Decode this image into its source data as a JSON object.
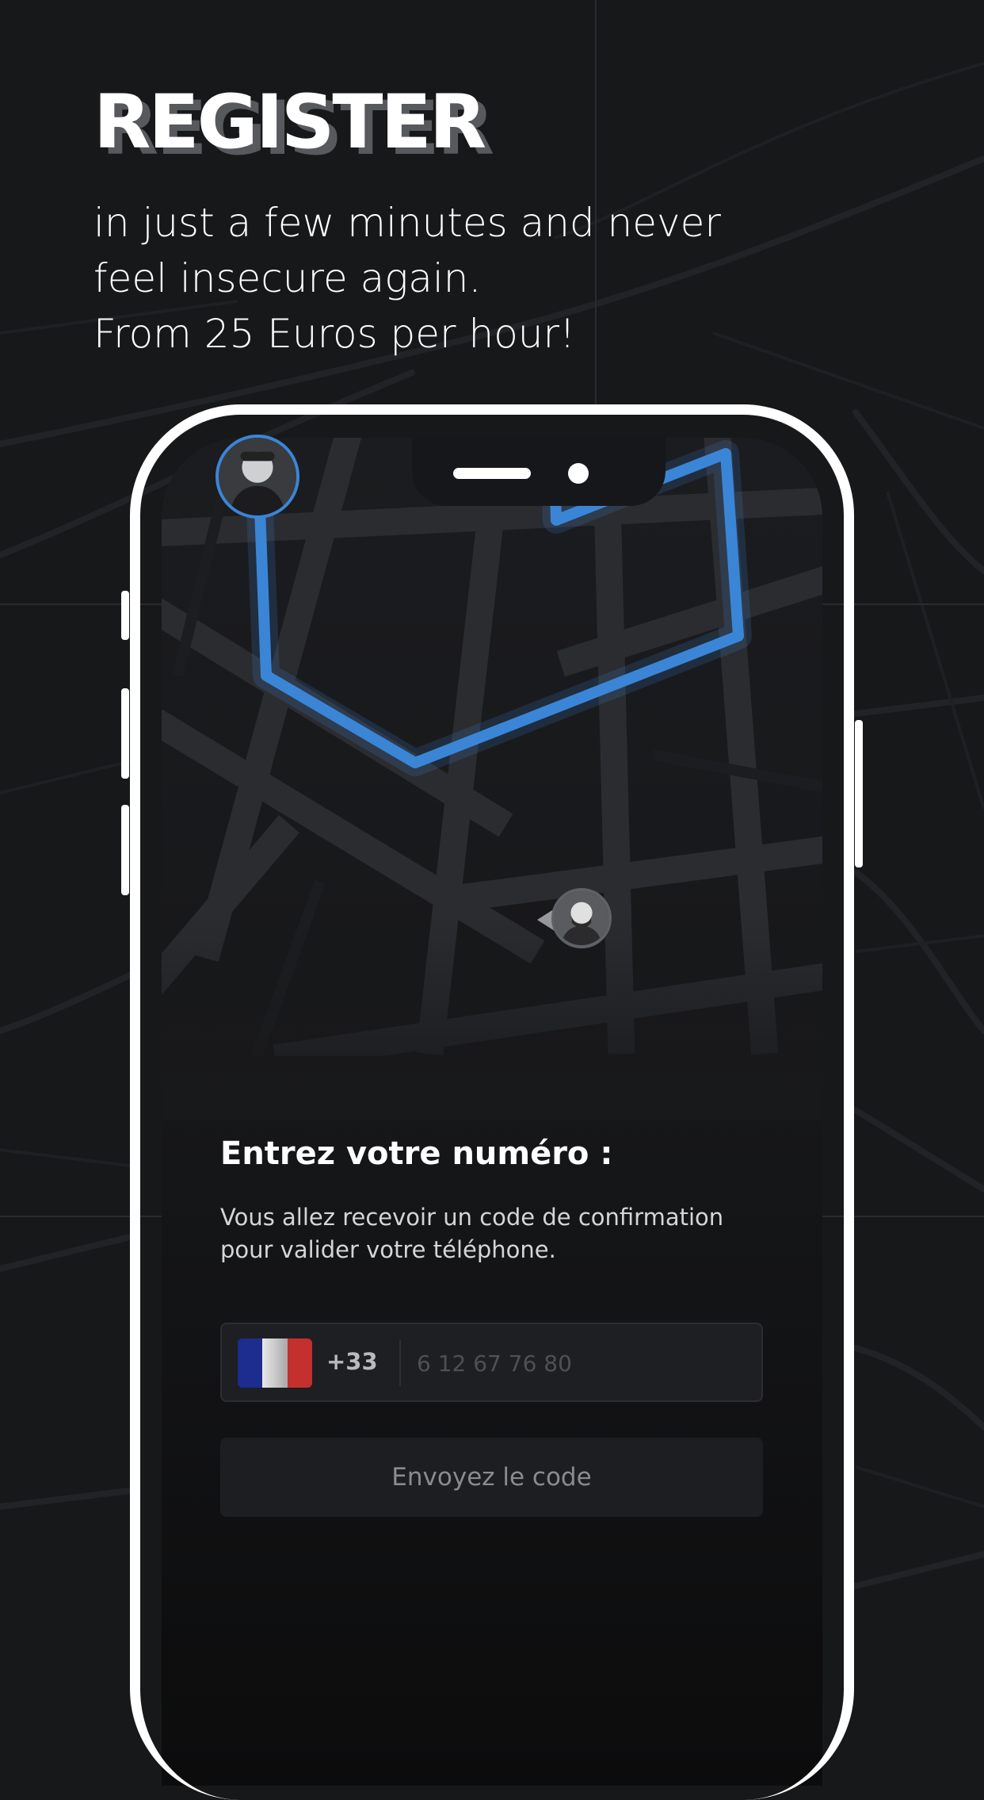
{
  "promo": {
    "headline": "REGISTER",
    "tagline_lines": [
      "in just a few minutes and never",
      "feel insecure again.",
      "From 25 Euros per hour!"
    ]
  },
  "app": {
    "form": {
      "title": "Entrez votre numéro :",
      "description_lines": [
        "Vous allez recevoir un code de confirmation",
        "pour valider votre téléphone."
      ],
      "country_flag": "france-flag-icon",
      "dial_code": "+33",
      "phone_placeholder": "6 12 67 76 80",
      "phone_value": "",
      "send_label": "Envoyez le code"
    },
    "map": {
      "route_color": "#3b85d6",
      "avatars": [
        "guardian-avatar",
        "client-avatar"
      ]
    }
  },
  "colors": {
    "background": "#17181a",
    "route": "#3b85d6",
    "flag_blue": "#1d2c8f",
    "flag_white": "#e8e8e8",
    "flag_red": "#c3302e"
  }
}
